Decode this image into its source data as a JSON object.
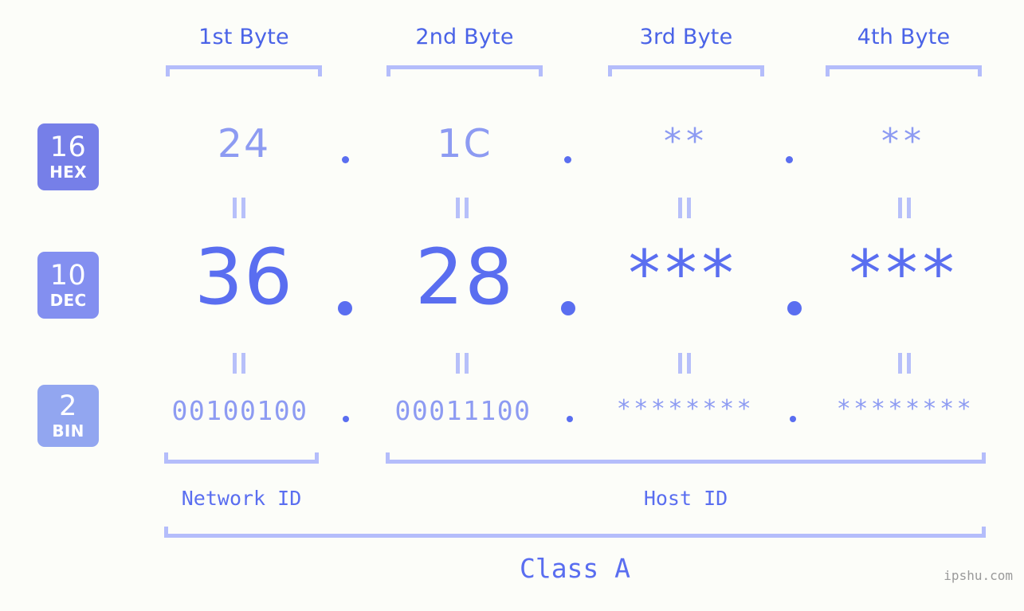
{
  "headers": [
    {
      "label": "1st Byte"
    },
    {
      "label": "2nd Byte"
    },
    {
      "label": "3rd Byte"
    },
    {
      "label": "4th Byte"
    }
  ],
  "bases": [
    {
      "num": "16",
      "name": "HEX",
      "color": "#767fe8"
    },
    {
      "num": "10",
      "name": "DEC",
      "color": "#838ff0"
    },
    {
      "num": "2",
      "name": "BIN",
      "color": "#92a6f0"
    }
  ],
  "rows": {
    "hex": {
      "values": [
        "24",
        "1C",
        "**",
        "**"
      ]
    },
    "dec": {
      "values": [
        "36",
        "28",
        "***",
        "***"
      ]
    },
    "bin": {
      "values": [
        "00100100",
        "00011100",
        "********",
        "********"
      ]
    }
  },
  "separators": {
    "dot": "."
  },
  "equals_mark": "||",
  "segments": {
    "network_id": "Network ID",
    "host_id": "Host ID"
  },
  "class_label": "Class A",
  "watermark": "ipshu.com",
  "colors": {
    "background": "#fcfdf9",
    "accent_strong": "#5a6ef0",
    "accent_light": "#8d9bf2",
    "bracket": "#b4bdfb",
    "header_text": "#4a63e7",
    "watermark_text": "#9a9a9a"
  }
}
